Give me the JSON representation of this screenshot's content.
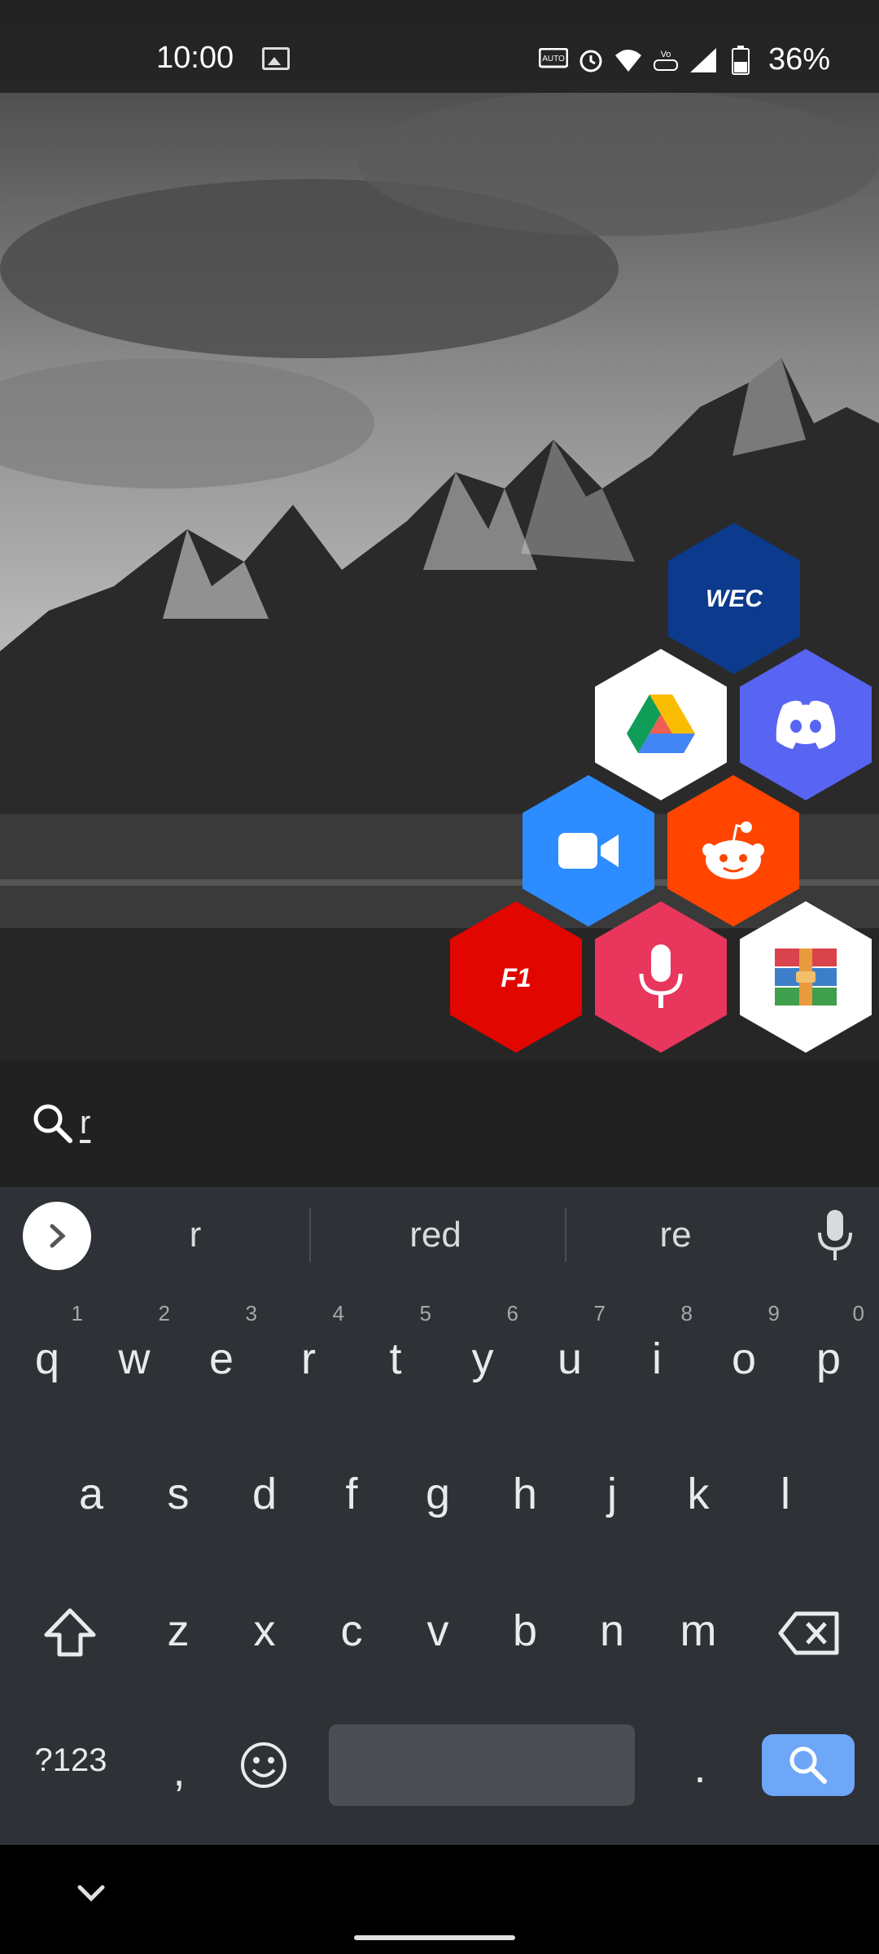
{
  "status_bar": {
    "time": "10:00",
    "icons": [
      "image-icon",
      "auto-hz-icon",
      "alarm-icon",
      "wifi-6-icon",
      "volte-icon",
      "signal-icon",
      "battery-icon"
    ],
    "battery_percent": "36%"
  },
  "apps": [
    {
      "name": "WEC",
      "label": "WEC",
      "color": "#0c3a8c"
    },
    {
      "name": "Google Drive",
      "color": "#ffffff"
    },
    {
      "name": "Discord",
      "color": "#5865f2"
    },
    {
      "name": "Zoom",
      "color": "#2d8cff"
    },
    {
      "name": "Reddit",
      "color": "#ff4500"
    },
    {
      "name": "F1",
      "label": "F1",
      "color": "#e10600"
    },
    {
      "name": "Voice Recorder",
      "color": "#e8365d"
    },
    {
      "name": "RAR",
      "color": "#ffffff"
    }
  ],
  "search": {
    "query": "r"
  },
  "suggestions": [
    "r",
    "red",
    "re"
  ],
  "keyboard": {
    "row1": [
      {
        "key": "q",
        "hint": "1"
      },
      {
        "key": "w",
        "hint": "2"
      },
      {
        "key": "e",
        "hint": "3"
      },
      {
        "key": "r",
        "hint": "4"
      },
      {
        "key": "t",
        "hint": "5"
      },
      {
        "key": "y",
        "hint": "6"
      },
      {
        "key": "u",
        "hint": "7"
      },
      {
        "key": "i",
        "hint": "8"
      },
      {
        "key": "o",
        "hint": "9"
      },
      {
        "key": "p",
        "hint": "0"
      }
    ],
    "row2": [
      "a",
      "s",
      "d",
      "f",
      "g",
      "h",
      "j",
      "k",
      "l"
    ],
    "row3": [
      "z",
      "x",
      "c",
      "v",
      "b",
      "n",
      "m"
    ],
    "symbols_label": "?123",
    "comma": ",",
    "period": ".",
    "accent_color": "#6ea6f8"
  }
}
